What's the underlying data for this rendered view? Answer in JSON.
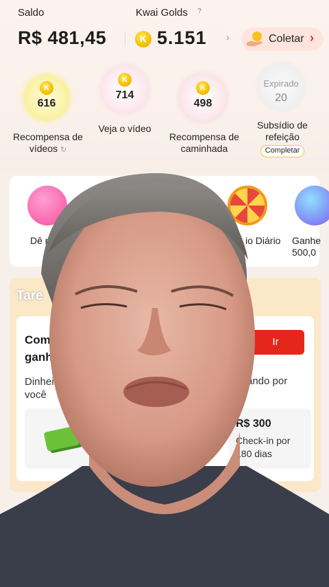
{
  "header": {
    "saldo_label": "Saldo",
    "golds_label": "Kwai Golds",
    "help_symbol": "?",
    "saldo_value": "R$ 481,45",
    "golds_value": "5.151",
    "coin_letter": "K",
    "coletar_label": "Coletar"
  },
  "rewards": [
    {
      "value": "616",
      "label": "Recompensa de vídeos"
    },
    {
      "value": "714",
      "label": "Veja o vídeo"
    },
    {
      "value": "498",
      "label": "Recompensa de caminhada"
    },
    {
      "status": "Expirado",
      "value": "20",
      "label": "Subsídio de refeição",
      "action": "Completar"
    }
  ],
  "games": {
    "item1_label": "Dê n",
    "item2_label": "io Diário",
    "item3_label_line1": "Ganhe",
    "item3_label_line2": "500,0"
  },
  "tasks": {
    "title": "Tare",
    "task_title_line1": "Com",
    "task_title_line2": "ganh",
    "ir_label": "Ir",
    "desc_line1": "Dinheir",
    "desc_line2": "você",
    "desc_right": "ando por",
    "reward_amount": "R$ 300",
    "reward_desc_line1": "Check-in por",
    "reward_desc_line2": "180 dias"
  },
  "colors": {
    "accent_red": "#e5271b",
    "coin_gold": "#f5c000"
  }
}
